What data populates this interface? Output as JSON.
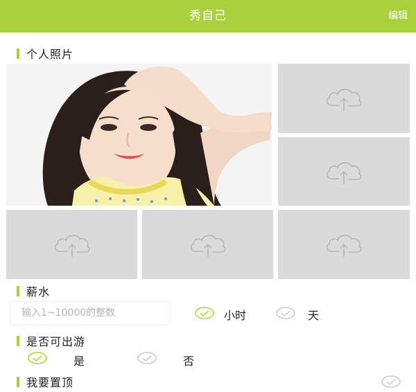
{
  "header": {
    "title": "秀自己",
    "edit_label": "编辑"
  },
  "photos_section": {
    "label": "个人照片"
  },
  "salary_section": {
    "label": "薪水",
    "input_placeholder": "输入1~10000的整数",
    "unit_options": [
      {
        "label": "小时",
        "selected": true
      },
      {
        "label": "天",
        "selected": false
      }
    ]
  },
  "travel_section": {
    "label": "是否可出游",
    "options": [
      {
        "label": "是",
        "selected": true
      },
      {
        "label": "否",
        "selected": false
      }
    ]
  },
  "top_section": {
    "label": "我要置顶",
    "selected": false
  },
  "colors": {
    "accent": "#a9d13c",
    "placeholder_bg": "#dadada",
    "icon_gray": "#b4b4b4"
  },
  "icons": [
    "upload-cloud-icon",
    "check-circle-icon"
  ]
}
